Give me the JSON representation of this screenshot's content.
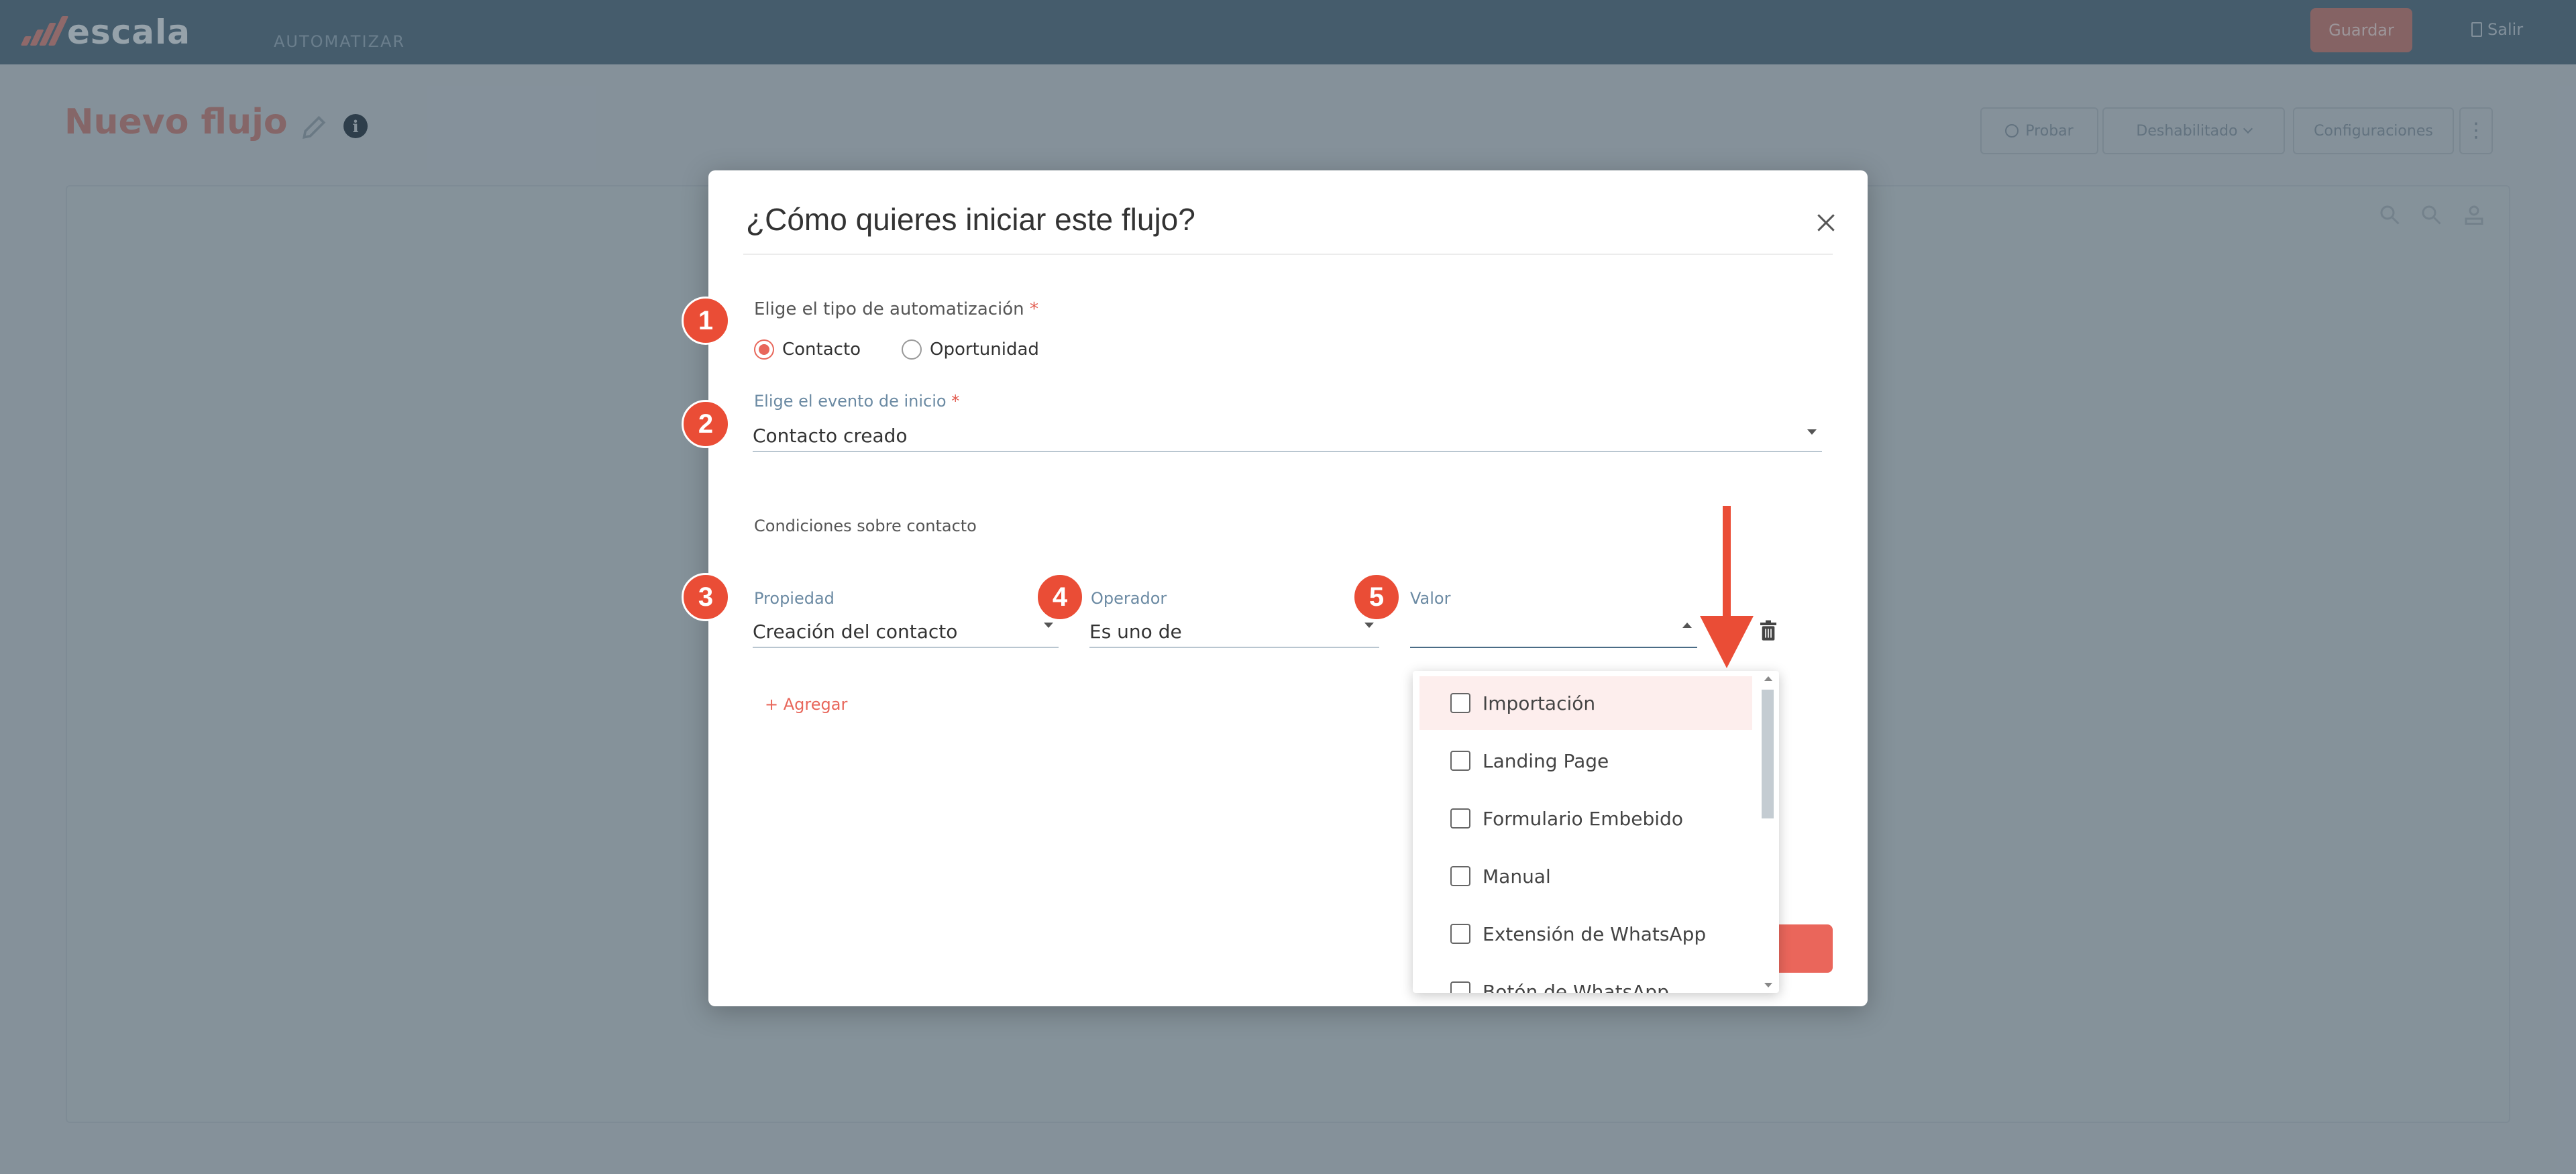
{
  "app": {
    "logo_text": "escala",
    "nav_item": "AUTOMATIZAR",
    "save_label": "Guardar",
    "logout_label": "Salir"
  },
  "page": {
    "title": "Nuevo flujo",
    "toolbar": {
      "test_label": "Probar",
      "status_label": "Deshabilitado",
      "settings_label": "Configuraciones"
    }
  },
  "modal": {
    "title": "¿Cómo quieres iniciar este flujo?",
    "automation_type": {
      "label": "Elige el tipo de automatización",
      "required_mark": "*",
      "options": [
        "Contacto",
        "Oportunidad"
      ],
      "selected": "Contacto"
    },
    "start_event": {
      "label": "Elige el evento de inicio",
      "required_mark": "*",
      "value": "Contacto creado"
    },
    "conditions": {
      "label": "Condiciones sobre contacto",
      "property_label": "Propiedad",
      "property_value": "Creación del contacto",
      "operator_label": "Operador",
      "operator_value": "Es uno de",
      "value_label": "Valor",
      "value_value": "",
      "add_label": "+ Agregar"
    },
    "value_dropdown": {
      "options": [
        "Importación",
        "Landing Page",
        "Formulario Embebido",
        "Manual",
        "Extensión de WhatsApp",
        "Botón de WhatsApp"
      ],
      "highlighted": "Importación"
    }
  },
  "annotations": {
    "badges": [
      "1",
      "2",
      "3",
      "4",
      "5"
    ],
    "color": "#ea4d36"
  },
  "colors": {
    "accent": "#e8665a",
    "topbar": "#5b7486",
    "label_blue": "#6b8aa3"
  }
}
